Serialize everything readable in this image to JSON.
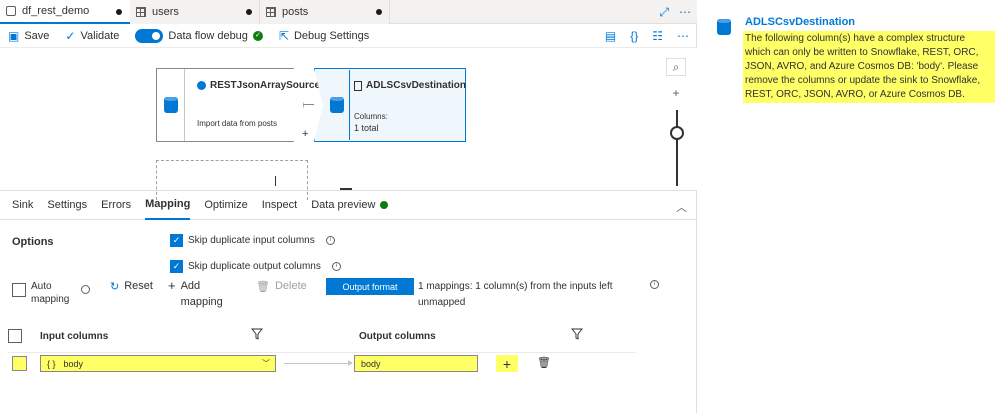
{
  "tabs": [
    {
      "label": "df_rest_demo",
      "active": true
    },
    {
      "label": "users",
      "active": false
    },
    {
      "label": "posts",
      "active": false
    }
  ],
  "toolbar": {
    "save": "Save",
    "validate": "Validate",
    "debug": "Data flow debug",
    "debug_settings": "Debug Settings"
  },
  "canvas": {
    "source": {
      "title": "RESTJsonArraySource",
      "sub": "Import data from posts"
    },
    "destination": {
      "title": "ADLSCsvDestination",
      "columns_label": "Columns:",
      "columns_value": "1 total"
    }
  },
  "bottom_tabs": [
    "Sink",
    "Settings",
    "Errors",
    "Mapping",
    "Optimize",
    "Inspect",
    "Data preview"
  ],
  "active_bottom_tab": "Mapping",
  "options": {
    "label": "Options",
    "skip_input": "Skip duplicate input columns",
    "skip_output": "Skip duplicate output columns"
  },
  "actions": {
    "auto_mapping_1": "Auto",
    "auto_mapping_2": "mapping",
    "reset": "Reset",
    "add_mapping_1": "Add",
    "add_mapping_2": "mapping",
    "delete": "Delete",
    "output_format": "Output format",
    "status_1": "1 mappings: 1 column(s) from the inputs left",
    "status_2": "unmapped"
  },
  "table": {
    "input_header": "Input columns",
    "output_header": "Output columns",
    "rows": [
      {
        "input_icon": "{ }",
        "input": "body",
        "output": "body"
      }
    ]
  },
  "panel": {
    "title": "ADLSCsvDestination",
    "message": "The following column(s) have a complex structure which can only be written to Snowflake, REST, ORC, JSON, AVRO, and Azure Cosmos DB: 'body'. Please remove the columns or update the sink to Snowflake, REST, ORC, JSON, AVRO, or Azure Cosmos DB."
  },
  "colors": {
    "accent": "#0078d4",
    "highlight": "#ffff66",
    "success": "#107c10"
  }
}
